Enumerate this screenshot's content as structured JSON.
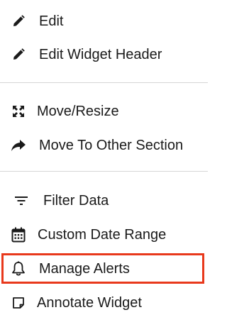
{
  "menu": {
    "items": [
      {
        "label": "Edit",
        "icon": "pencil-icon"
      },
      {
        "label": "Edit Widget Header",
        "icon": "pencil-icon"
      },
      {
        "label": "Move/Resize",
        "icon": "expand-arrows-icon"
      },
      {
        "label": "Move To Other Section",
        "icon": "share-arrow-icon"
      },
      {
        "label": "Filter Data",
        "icon": "filter-lines-icon"
      },
      {
        "label": "Custom Date Range",
        "icon": "calendar-icon"
      },
      {
        "label": "Manage Alerts",
        "icon": "bell-icon"
      },
      {
        "label": "Annotate Widget",
        "icon": "note-icon"
      }
    ]
  },
  "colors": {
    "highlight": "#e8391c",
    "divider": "#d6d6d6",
    "text": "#1a1a1a"
  }
}
